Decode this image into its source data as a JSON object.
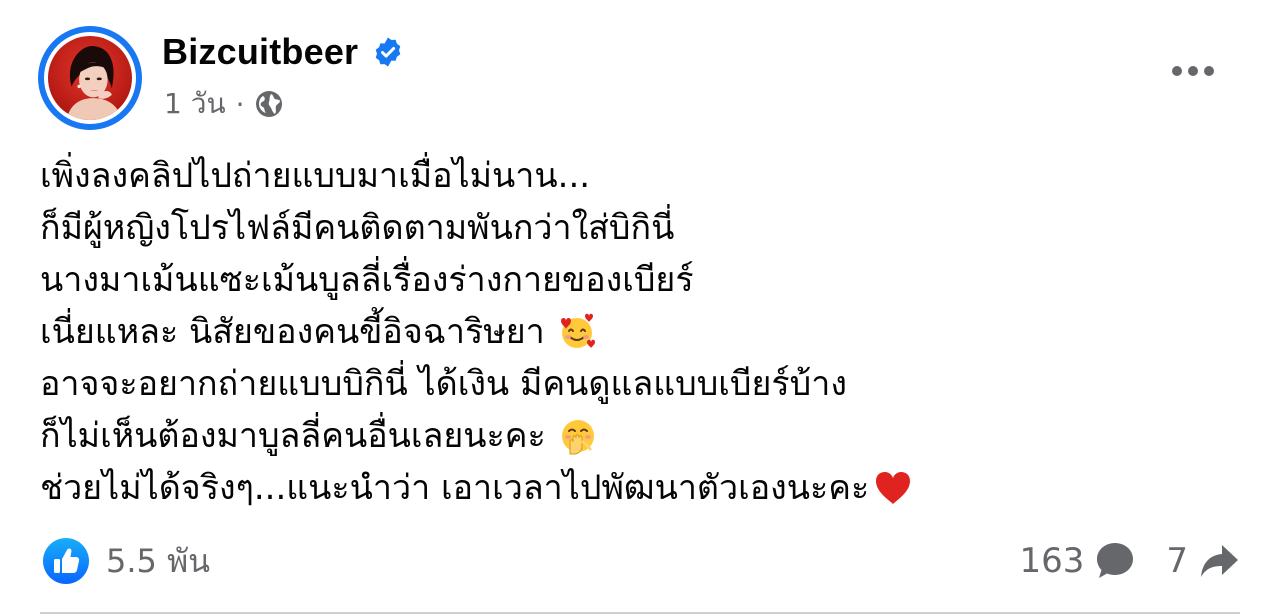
{
  "post": {
    "author": {
      "name": "Bizcuitbeer",
      "verified": true,
      "avatar_icon": "profile-photo"
    },
    "meta": {
      "time": "1 วัน",
      "separator": "·",
      "audience_icon": "globe-icon"
    },
    "more_icon": "more-options-icon",
    "text_lines": [
      {
        "text": "เพิ่งลงคลิปไปถ่ายแบบมาเมื่อไม่นาน...",
        "emoji": ""
      },
      {
        "text": "ก็มีผู้หญิงโปรไฟล์มีคนติดตามพันกว่าใส่บิกินี่",
        "emoji": ""
      },
      {
        "text": "นางมาเม้นแซะเม้นบูลลี่เรื่องร่างกายของเบียร์",
        "emoji": ""
      },
      {
        "text": "เนี่ยแหละ นิสัยของคนขี้อิจฉาริษยา",
        "emoji": "smiling-face-with-hearts"
      },
      {
        "text": "อาจจะอยากถ่ายแบบบิกินี่ ได้เงิน มีคนดูแลแบบเบียร์บ้าง",
        "emoji": ""
      },
      {
        "text": "ก็ไม่เห็นต้องมาบูลลี่คนอื่นเลยนะคะ",
        "emoji": "face-with-hand-over-mouth"
      },
      {
        "text": "ช่วยไม่ได้จริงๆ...แนะนำว่า เอาเวลาไปพัฒนาตัวเองนะคะ",
        "emoji": "red-heart"
      }
    ],
    "reactions": {
      "icon": "like-icon",
      "count": "5.5 พัน"
    },
    "comments": {
      "count": "163",
      "icon": "comment-icon"
    },
    "shares": {
      "count": "7",
      "icon": "share-icon"
    }
  },
  "colors": {
    "facebook_blue": "#1877f2",
    "secondary_text": "#65676b",
    "primary_text": "#050505",
    "heart_red": "#e0231f"
  }
}
